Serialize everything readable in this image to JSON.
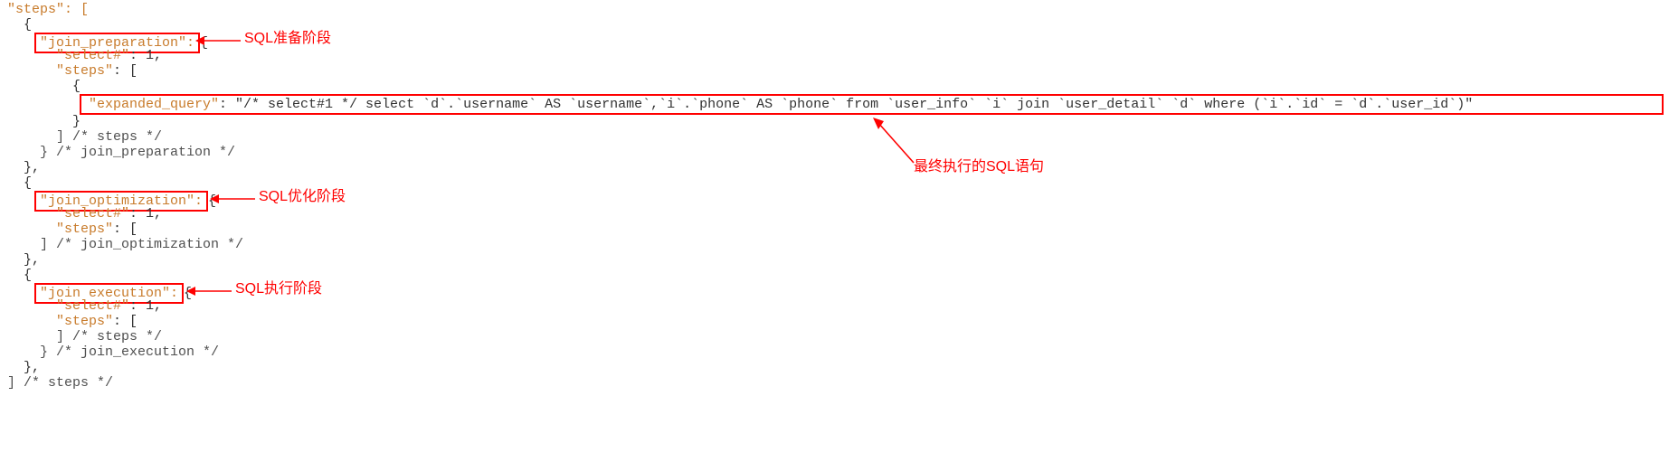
{
  "lines": {
    "l0": "\"steps\": [",
    "l1": "{",
    "l2_key": "\"join_preparation\": ",
    "l2_tail": "{",
    "l3_key": "\"select#\"",
    "l3_rest": ": 1,",
    "l4_key": "\"steps\"",
    "l4_rest": ": [",
    "l5": "{",
    "l6_key": "\"expanded_query\"",
    "l6_rest": ": \"/* select#1 */ select `d`.`username` AS `username`,`i`.`phone` AS `phone` from `user_info` `i` join `user_detail` `d` where (`i`.`id` = `d`.`user_id`)\"",
    "l7": "}",
    "l8": "] /* steps */",
    "l9": "} /* join_preparation */",
    "l10": "},",
    "l11": "{",
    "l12_key": "\"join_optimization\": ",
    "l12_tail": "{",
    "l13_key": "\"select#\"",
    "l13_rest": ": 1,",
    "l14_key": "\"steps\"",
    "l14_rest": ": [",
    "l15": "] /* join_optimization */",
    "l16": "},",
    "l17": "{",
    "l18_key": "\"join execution\": ",
    "l18_tail": "{",
    "l19_key": "\"select#\"",
    "l19_rest": ": 1,",
    "l20_key": "\"steps\"",
    "l20_rest": ": [",
    "l21": "] /* steps */",
    "l22": "} /* join_execution */",
    "l23": "},",
    "l24": "] /* steps */"
  },
  "annotations": {
    "prep": "SQL准备阶段",
    "opt": "SQL优化阶段",
    "exec": "SQL执行阶段",
    "final": "最终执行的SQL语句"
  }
}
